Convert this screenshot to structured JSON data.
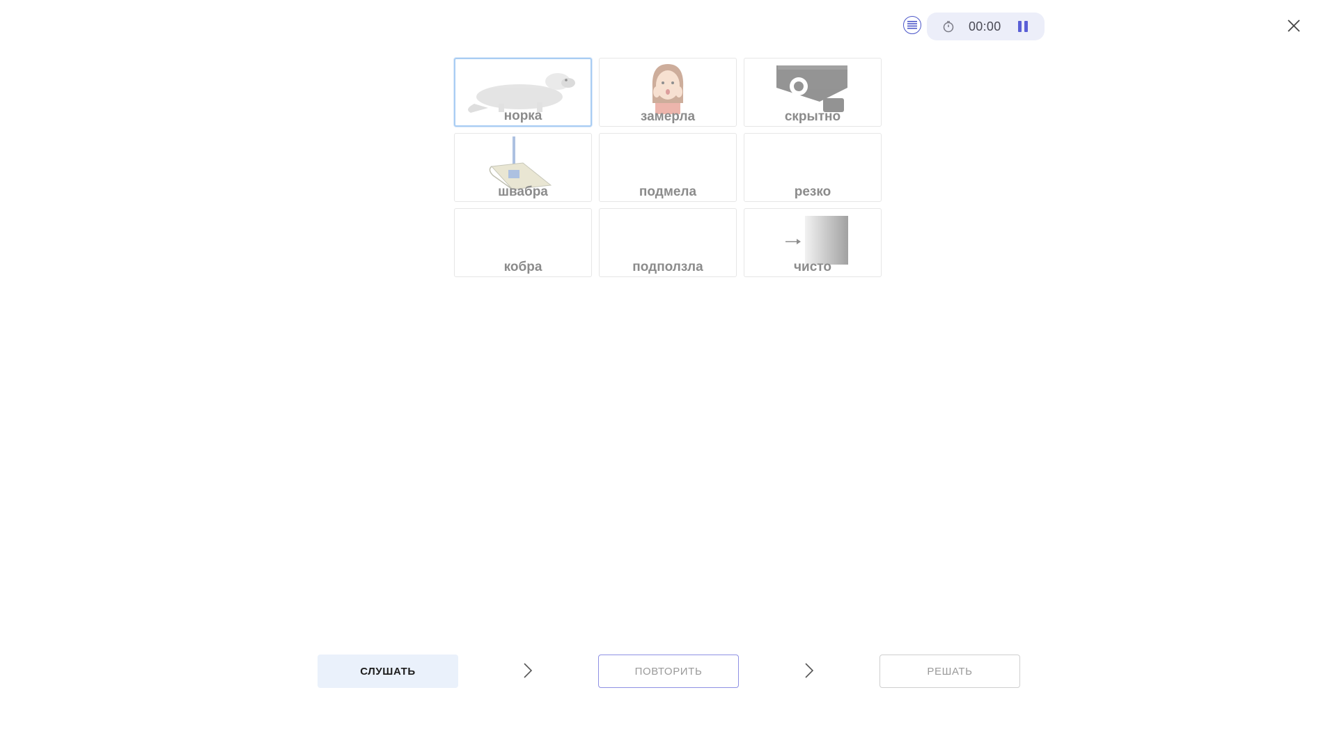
{
  "header": {
    "timer": "00:00",
    "icons": {
      "menu": "list-menu-icon",
      "clock": "stopwatch-icon",
      "pause": "pause-icon",
      "close": "close-icon"
    }
  },
  "cards": [
    {
      "word": "норка",
      "image": "mink",
      "selected": true
    },
    {
      "word": "замерла",
      "image": "surprised-woman",
      "selected": false
    },
    {
      "word": "скрытно",
      "image": "security-camera",
      "selected": false
    },
    {
      "word": "швабра",
      "image": "mop",
      "selected": false
    },
    {
      "word": "подмела",
      "image": "",
      "selected": false
    },
    {
      "word": "резко",
      "image": "",
      "selected": false
    },
    {
      "word": "кобра",
      "image": "",
      "selected": false
    },
    {
      "word": "подползла",
      "image": "",
      "selected": false
    },
    {
      "word": "чисто",
      "image": "arrow-gradient",
      "selected": false
    }
  ],
  "footer": {
    "listen_label": "СЛУШАТЬ",
    "repeat_label": "ПОВТОРИТЬ",
    "solve_label": "РЕШАТЬ"
  },
  "colors": {
    "accent": "#4b56c9",
    "pill_bg": "#eceef9",
    "selected_border": "#a9cdf3",
    "listen_bg": "#eaf1fb",
    "repeat_border": "#8e90e3"
  }
}
